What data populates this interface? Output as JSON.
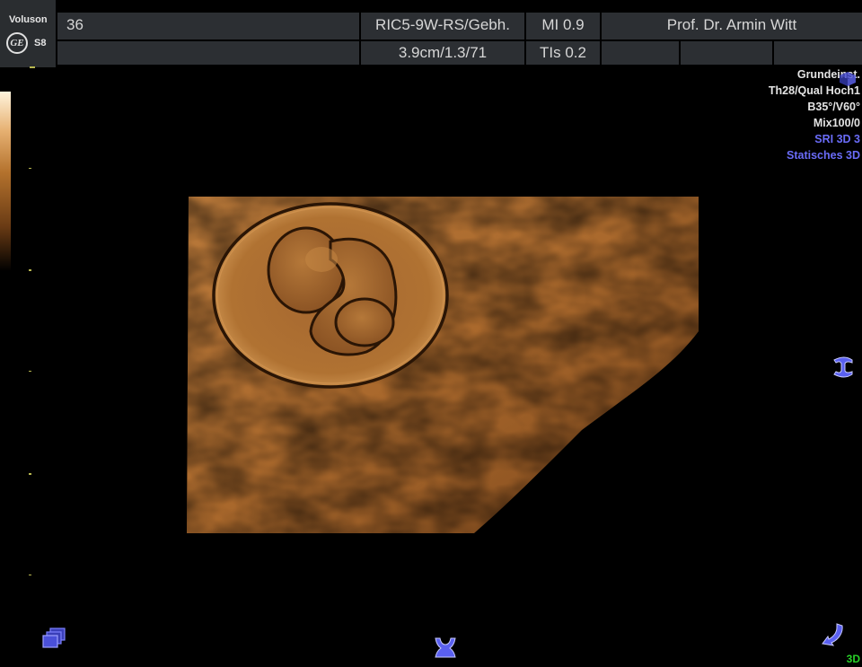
{
  "header": {
    "brand": "Voluson",
    "logo_text": "GE",
    "model": "S8",
    "frame_number": "36",
    "probe": "RIC5-9W-RS/Gebh.",
    "depth_info": "3.9cm/1.3/71",
    "mi": "MI  0.9",
    "tis": "TIs  0.2",
    "operator": "Prof. Dr. Armin Witt"
  },
  "settings": {
    "preset": "Grundeinst.",
    "quality": "Th28/Qual Hoch1",
    "angles": "B35°/V60°",
    "mix": "Mix100/0",
    "sri": "SRI 3D 3",
    "mode": "Statisches 3D"
  },
  "mode_label": "3D",
  "colors": {
    "header_cell": "#2c2f33",
    "text_blue": "#6a6cf8",
    "text_green": "#29d128",
    "tick_yellow": "#b7b64f",
    "skin_tone": "#b7793c"
  },
  "icons": {
    "logo": "ge-monogram-icon",
    "top_right": "3d-orientation-icon",
    "right_middle": "rotate-y-icon",
    "bottom_left": "multi-view-icon",
    "bottom_center": "rotate-z-icon",
    "bottom_right": "rotate-x-icon"
  }
}
